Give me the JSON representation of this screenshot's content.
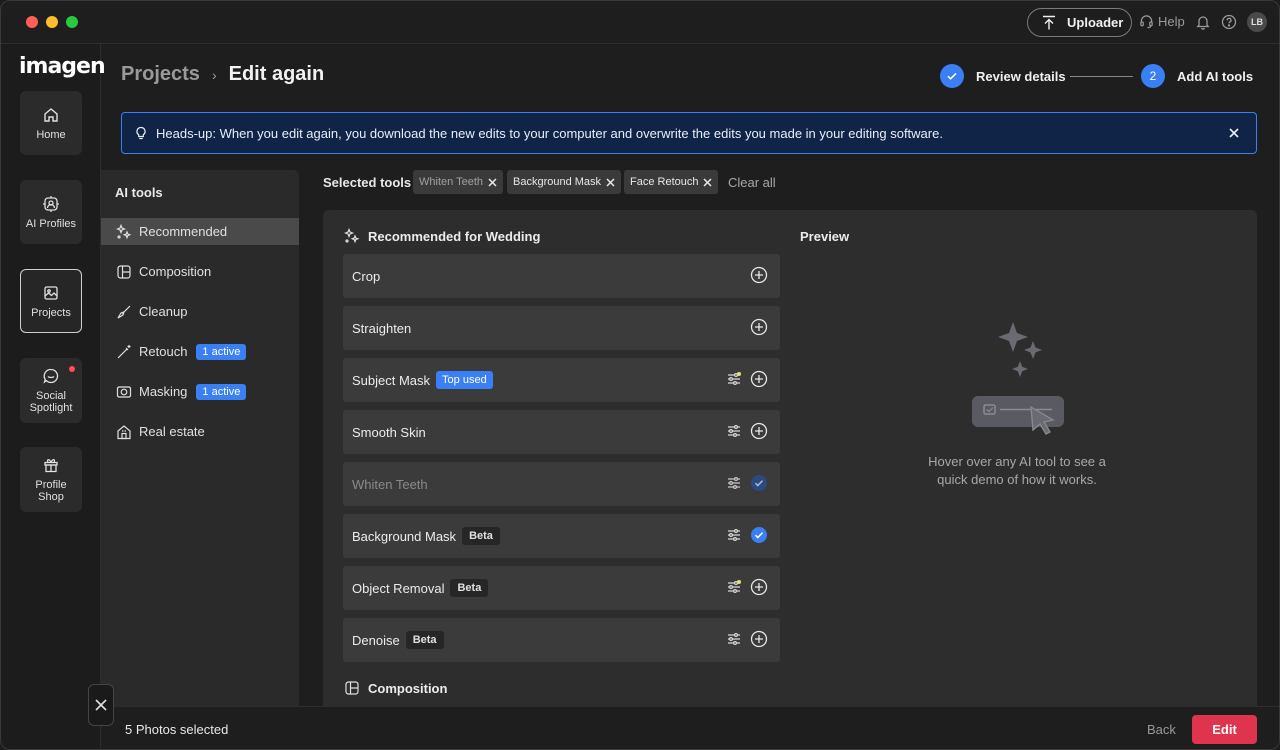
{
  "titlebar": {
    "uploader_label": "Uploader",
    "help_label": "Help",
    "avatar_initials": "LB"
  },
  "rail": {
    "logo": "imagen",
    "items": [
      {
        "label": "Home",
        "icon": "home-icon"
      },
      {
        "label": "AI Profiles",
        "icon": "ai-profiles-icon"
      },
      {
        "label": "Projects",
        "icon": "projects-icon",
        "active": true
      },
      {
        "label": "Social Spotlight",
        "icon": "social-spotlight-icon",
        "notification": true
      },
      {
        "label": "Profile Shop",
        "icon": "profile-shop-icon"
      }
    ]
  },
  "header": {
    "breadcrumb_parent": "Projects",
    "breadcrumb_current": "Edit again",
    "steps": [
      {
        "label": "Review details",
        "state": "done"
      },
      {
        "number": "2",
        "label": "Add AI tools",
        "state": "current"
      }
    ]
  },
  "banner": {
    "text": "Heads-up: When you edit again, you download the new edits to your computer and overwrite the edits you made in your editing software."
  },
  "tools_sidebar": {
    "title": "AI tools",
    "categories": [
      {
        "label": "Recommended",
        "icon": "sparkles-icon",
        "active": true
      },
      {
        "label": "Composition",
        "icon": "composition-icon"
      },
      {
        "label": "Cleanup",
        "icon": "brush-icon"
      },
      {
        "label": "Retouch",
        "icon": "wand-icon",
        "badge": "1 active"
      },
      {
        "label": "Masking",
        "icon": "mask-icon",
        "badge": "1 active"
      },
      {
        "label": "Real estate",
        "icon": "house-icon"
      }
    ]
  },
  "selected_tools": {
    "label": "Selected tools",
    "chips": [
      "Whiten Teeth",
      "Background Mask",
      "Face Retouch"
    ],
    "clear_all": "Clear all"
  },
  "recommended": {
    "heading": "Recommended for Wedding",
    "rows": [
      {
        "name": "Crop",
        "tag": "",
        "settings": false,
        "selected": false
      },
      {
        "name": "Straighten",
        "tag": "",
        "settings": false,
        "selected": false
      },
      {
        "name": "Subject Mask",
        "tag": "Top used",
        "settings": true,
        "selected": false
      },
      {
        "name": "Smooth Skin",
        "tag": "",
        "settings": true,
        "selected": false
      },
      {
        "name": "Whiten Teeth",
        "tag": "",
        "settings": true,
        "selected": true
      },
      {
        "name": "Background Mask",
        "tag": "Beta",
        "settings": true,
        "selected": true
      },
      {
        "name": "Object Removal",
        "tag": "Beta",
        "settings": true,
        "selected": false
      },
      {
        "name": "Denoise",
        "tag": "Beta",
        "settings": true,
        "selected": false
      }
    ],
    "next_section": "Composition"
  },
  "preview": {
    "title": "Preview",
    "hint": "Hover over any AI tool to see a quick demo of how it works."
  },
  "bottom": {
    "photos_selected": "5 Photos selected",
    "back": "Back",
    "edit": "Edit"
  },
  "colors": {
    "accent_blue": "#3b7ff5",
    "edit_red": "#e0334d",
    "banner_bg": "#0f2446"
  }
}
